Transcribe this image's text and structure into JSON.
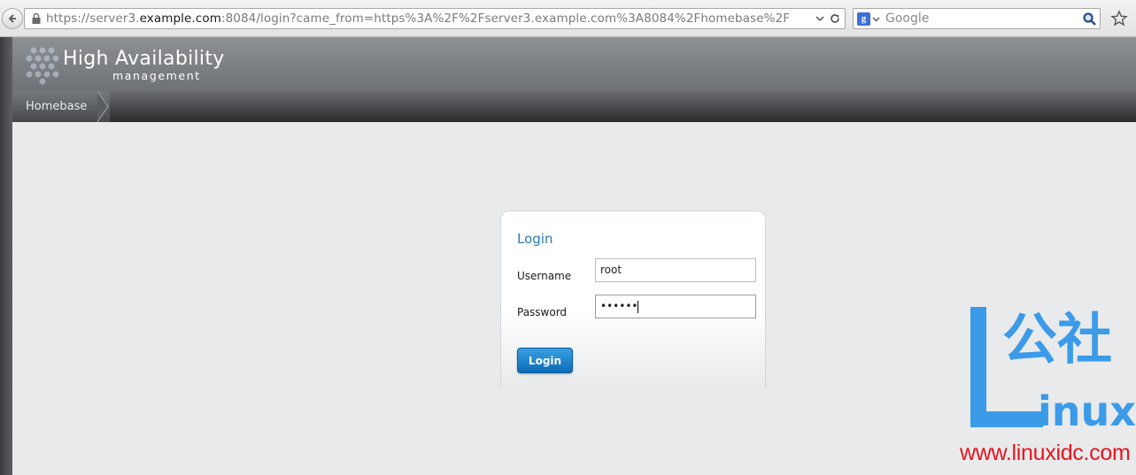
{
  "browser": {
    "url_prefix": "https://server3.",
    "url_domain": "example.com",
    "url_rest": ":8084/login?came_from=https%3A%2F%2Fserver3.example.com%3A8084%2Fhomebase%2F",
    "search_placeholder": "Google",
    "search_engine_letter": "g"
  },
  "app": {
    "title": "High Availability",
    "subtitle": "management"
  },
  "breadcrumb": {
    "items": [
      {
        "label": "Homebase"
      }
    ]
  },
  "login": {
    "title": "Login",
    "username_label": "Username",
    "username_value": "root",
    "password_label": "Password",
    "password_value": "••••••",
    "button_label": "Login"
  },
  "watermark": {
    "logo_text": "L公社 inux",
    "url": "www.linuxidc.com"
  },
  "colors": {
    "accent": "#2a7ab8",
    "button": "#0b6cb6",
    "watermark_blue": "#3b9be8",
    "watermark_red": "#e8141c"
  }
}
